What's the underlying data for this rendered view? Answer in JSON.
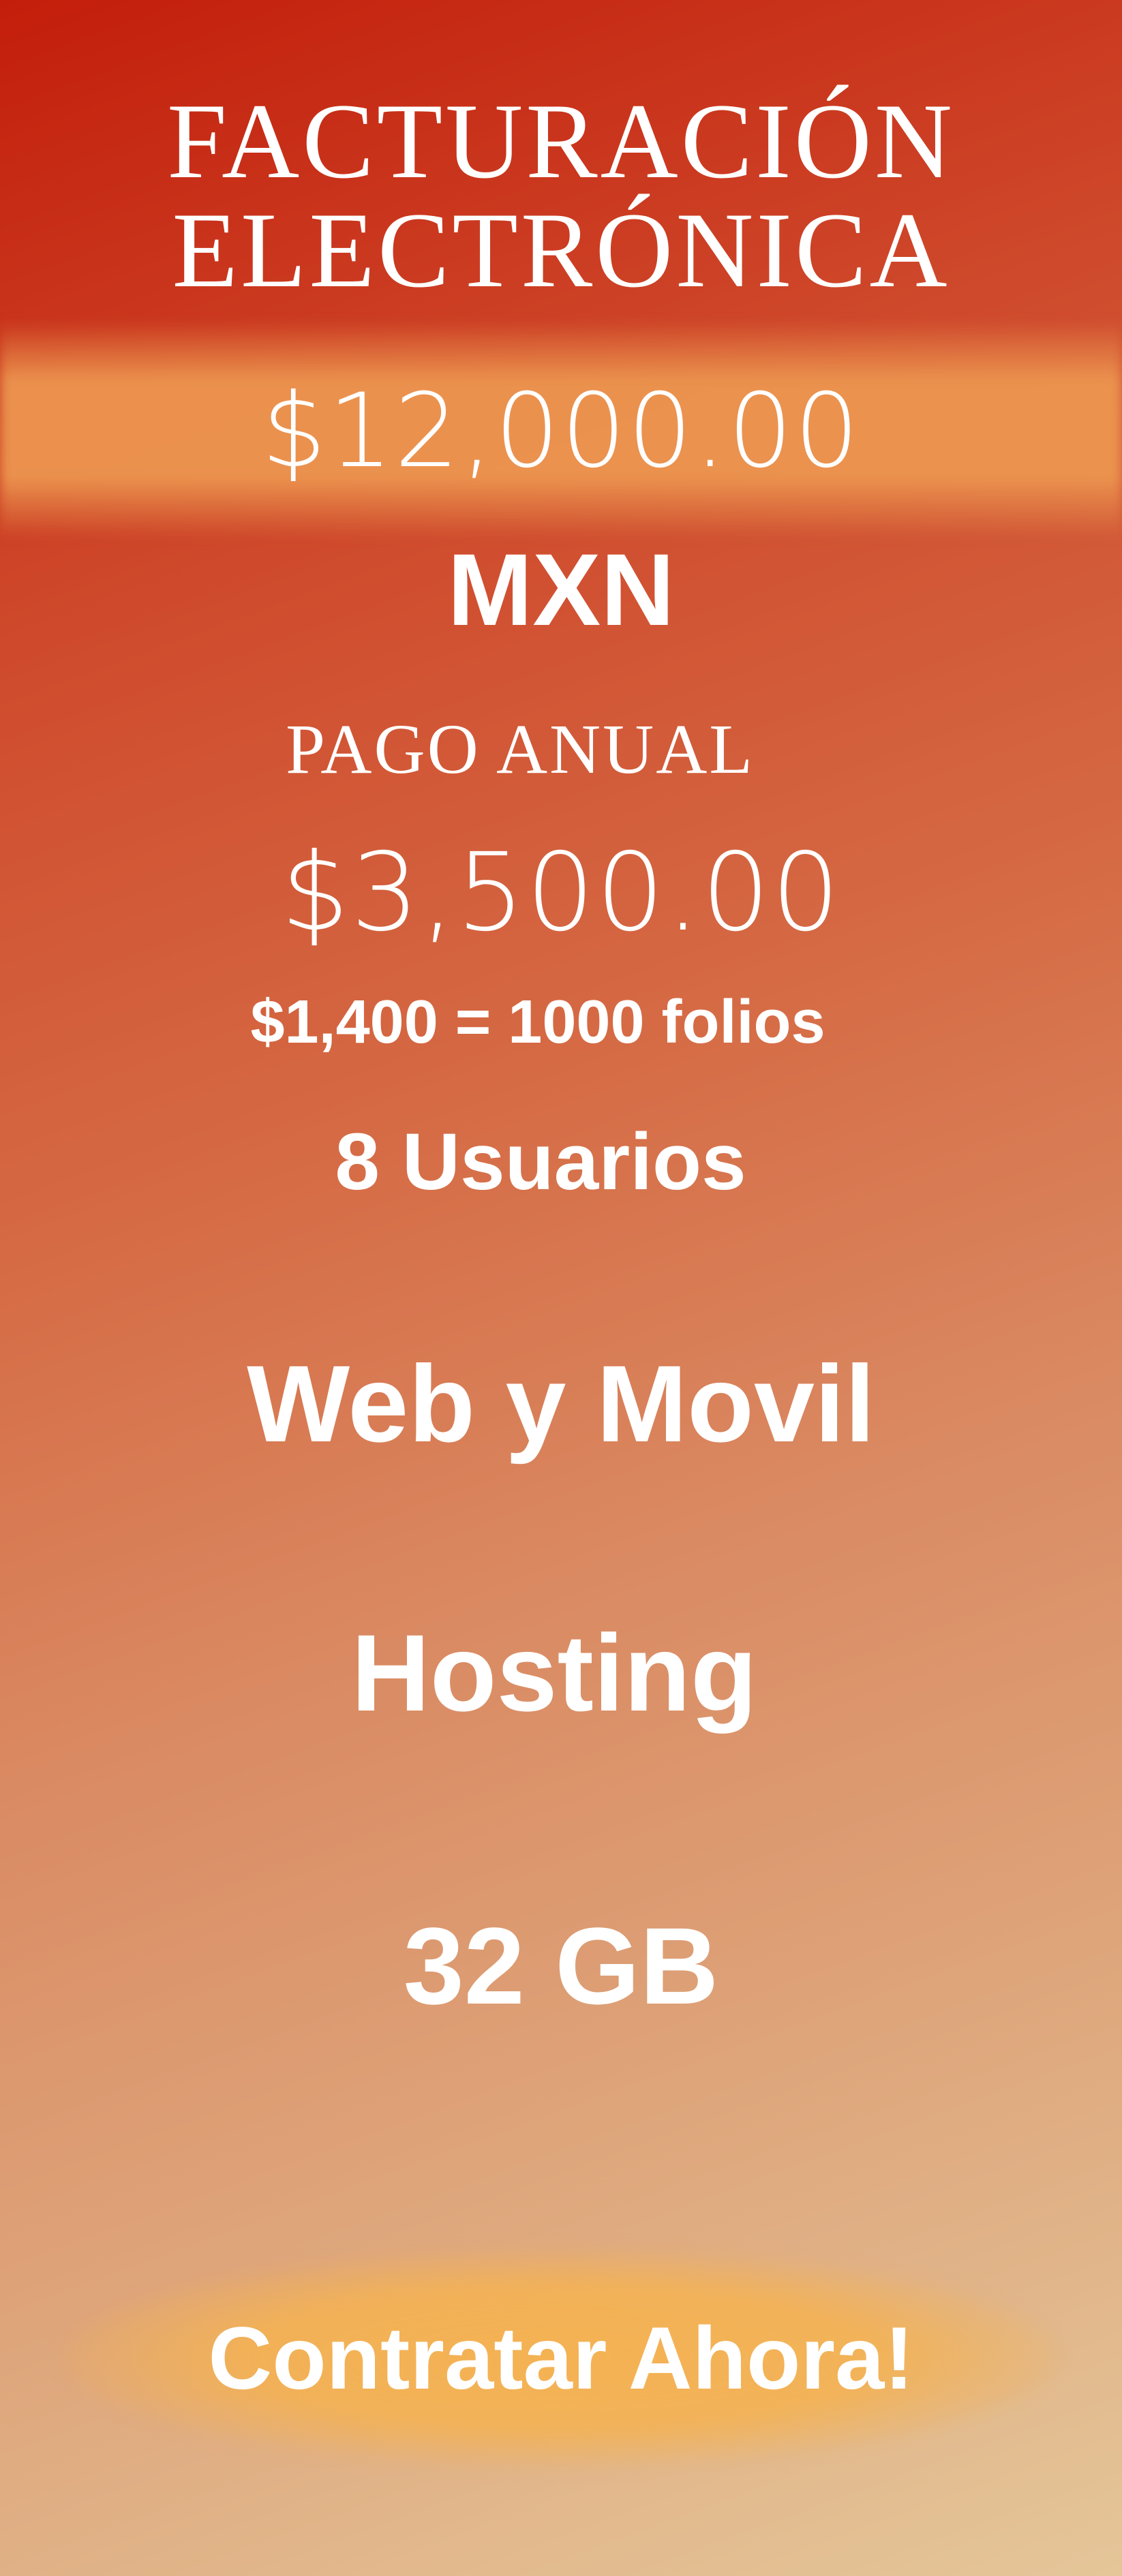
{
  "header": {
    "title_line1": "FACTURACIÓN",
    "title_line2": "ELECTRÓNICA"
  },
  "pricing": {
    "main_price": "$12,000.00",
    "currency": "MXN",
    "plan_label": "PAGO ANUAL",
    "annual_price": "$3,500.00",
    "folios_offer": "$1,400 = 1000 folios",
    "users": "8 Usuarios"
  },
  "features": [
    "Web y Movil",
    "Hosting",
    "32 GB"
  ],
  "cta": {
    "label": "Contratar Ahora!"
  },
  "colors": {
    "top_red": "#c31e0b",
    "band_orange": "#ec9650",
    "bottom_tan": "#e4c699",
    "text": "#ffffff"
  }
}
